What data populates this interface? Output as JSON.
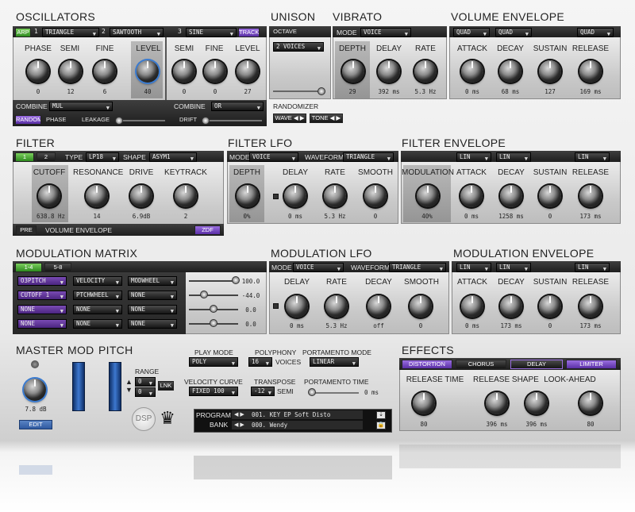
{
  "osc": {
    "title": "OSCILLATORS",
    "arp": "ARP",
    "num1": "1",
    "wave1": "TRIANGLE",
    "num2": "2",
    "wave2": "SAWTOOTH",
    "num3": "3",
    "wave3": "SINE",
    "track": "TRACK",
    "k": [
      {
        "l": "PHASE",
        "v": "0"
      },
      {
        "l": "SEMI",
        "v": "12"
      },
      {
        "l": "FINE",
        "v": "6"
      },
      {
        "l": "LEVEL",
        "v": "40"
      },
      {
        "l": "SEMI",
        "v": "0"
      },
      {
        "l": "FINE",
        "v": "0"
      },
      {
        "l": "LEVEL",
        "v": "27"
      }
    ],
    "combine": "COMBINE",
    "combine1": "MUL",
    "combine2": "OR",
    "random": "RANDOM",
    "phase": "PHASE",
    "leakage": "LEAKAGE",
    "drift": "DRIFT"
  },
  "unison": {
    "title": "UNISON",
    "octave": "OCTAVE",
    "voices": "2 VOICES",
    "randomizer": "RANDOMIZER",
    "wave": "WAVE ◀ ▶",
    "tone": "TONE ◀ ▶"
  },
  "vibrato": {
    "title": "VIBRATO",
    "mode": "MODE",
    "mode_val": "VOICE",
    "k": [
      {
        "l": "DEPTH",
        "v": "29"
      },
      {
        "l": "DELAY",
        "v": "392 ms"
      },
      {
        "l": "RATE",
        "v": "5.3 Hz"
      }
    ]
  },
  "volenv": {
    "title": "VOLUME ENVELOPE",
    "c1": "QUAD",
    "c2": "QUAD",
    "c3": "QUAD",
    "k": [
      {
        "l": "ATTACK",
        "v": "0 ms"
      },
      {
        "l": "DECAY",
        "v": "68 ms"
      },
      {
        "l": "SUSTAIN",
        "v": "127"
      },
      {
        "l": "RELEASE",
        "v": "169 ms"
      }
    ]
  },
  "filter": {
    "title": "FILTER",
    "n1": "1",
    "n2": "2",
    "type": "TYPE",
    "type_val": "LP18",
    "shape": "SHAPE",
    "shape_val": "ASYM1",
    "k": [
      {
        "l": "CUTOFF",
        "v": "638.8 Hz"
      },
      {
        "l": "RESONANCE",
        "v": "14"
      },
      {
        "l": "DRIVE",
        "v": "6.9dB"
      },
      {
        "l": "KEYTRACK",
        "v": "2"
      }
    ],
    "pre": "PRE",
    "env": "VOLUME ENVELOPE",
    "zdf": "ZDF"
  },
  "flfo": {
    "title": "FILTER LFO",
    "mode": "MODE",
    "mode_val": "VOICE",
    "waveform": "WAVEFORM",
    "wave_val": "TRIANGLE",
    "k": [
      {
        "l": "DEPTH",
        "v": "0%"
      },
      {
        "l": "DELAY",
        "v": "0 ms"
      },
      {
        "l": "RATE",
        "v": "5.3 Hz"
      },
      {
        "l": "SMOOTH",
        "v": "0"
      }
    ]
  },
  "fenv": {
    "title": "FILTER ENVELOPE",
    "c1": "LIN",
    "c2": "LIN",
    "c3": "LIN",
    "k": [
      {
        "l": "MODULATION",
        "v": "40%"
      },
      {
        "l": "ATTACK",
        "v": "0 ms"
      },
      {
        "l": "DECAY",
        "v": "1258 ms"
      },
      {
        "l": "SUSTAIN",
        "v": "0"
      },
      {
        "l": "RELEASE",
        "v": "173 ms"
      }
    ]
  },
  "matrix": {
    "title": "MODULATION MATRIX",
    "tab1": "1-4",
    "tab2": "5-8",
    "rows": [
      {
        "d": "O3PITCH",
        "s1": "VELOCITY",
        "s2": "MODWHEEL",
        "v": "100.0"
      },
      {
        "d": "CUTOFF 1",
        "s1": "PTCHWHEEL",
        "s2": "NONE",
        "v": "-44.0"
      },
      {
        "d": "NONE",
        "s1": "NONE",
        "s2": "NONE",
        "v": "0.0"
      },
      {
        "d": "NONE",
        "s1": "NONE",
        "s2": "NONE",
        "v": "0.0"
      }
    ]
  },
  "mlfo": {
    "title": "MODULATION LFO",
    "mode": "MODE",
    "mode_val": "VOICE",
    "waveform": "WAVEFORM",
    "wave_val": "TRIANGLE",
    "k": [
      {
        "l": "DELAY",
        "v": "0 ms"
      },
      {
        "l": "RATE",
        "v": "5.3 Hz"
      },
      {
        "l": "DECAY",
        "v": "off"
      },
      {
        "l": "SMOOTH",
        "v": "0"
      }
    ]
  },
  "menv": {
    "title": "MODULATION ENVELOPE",
    "c1": "LIN",
    "c2": "LIN",
    "c3": "LIN",
    "k": [
      {
        "l": "ATTACK",
        "v": "0 ms"
      },
      {
        "l": "DECAY",
        "v": "173 ms"
      },
      {
        "l": "SUSTAIN",
        "v": "0"
      },
      {
        "l": "RELEASE",
        "v": "173 ms"
      }
    ]
  },
  "bottom": {
    "master": "MASTER",
    "mod": "MOD",
    "pitch": "PITCH",
    "range": "RANGE",
    "r1": "0",
    "r2": "0",
    "lnk": "LNK",
    "master_val": "7.8 dB",
    "edit": "EDIT",
    "playmode": "PLAY MODE",
    "playmode_val": "POLY",
    "polyphony": "POLYPHONY",
    "poly_val": "16",
    "voices": "VOICES",
    "portmode": "PORTAMENTO MODE",
    "portmode_val": "LINEAR",
    "velcurve": "VELOCITY CURVE",
    "vel_val": "FIXED 100",
    "transpose": "TRANSPOSE",
    "trans_val": "-12",
    "semi": "SEMI",
    "porttime": "PORTAMENTO TIME",
    "porttime_val": "0 ms",
    "program": "PROGRAM",
    "bank": "BANK",
    "program_val": "001. KEY EP Soft Disto",
    "bank_val": "000. Wendy",
    "dsp": "DSP"
  },
  "effects": {
    "title": "EFFECTS",
    "tabs": [
      "DISTORTION",
      "CHORUS",
      "DELAY",
      "LIMITER"
    ],
    "k": [
      {
        "l": "RELEASE TIME",
        "v": "80"
      },
      {
        "l": "RELEASE SHAPE",
        "v": "396 ms"
      },
      {
        "l": "",
        "v": "396 ms"
      },
      {
        "l": "LOOK-AHEAD",
        "v": "80"
      }
    ]
  }
}
